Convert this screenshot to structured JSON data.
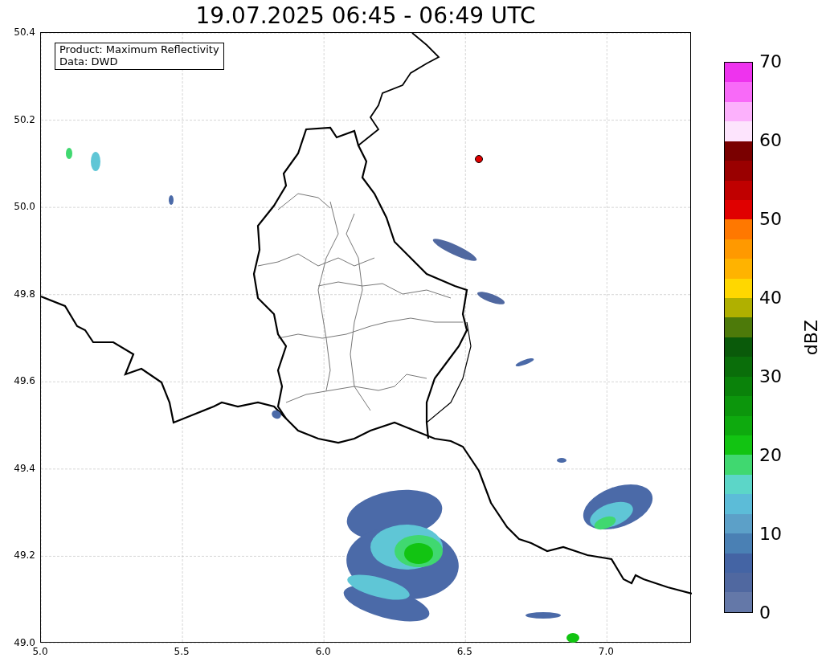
{
  "title": "19.07.2025 06:45 - 06:49 UTC",
  "legend": [
    "Product: Maximum Reflectivity",
    "Data: DWD"
  ],
  "x_ticks": [
    "5.0",
    "5.5",
    "6.0",
    "6.5",
    "7.0"
  ],
  "y_ticks": [
    "50.4",
    "50.2",
    "50.0",
    "49.8",
    "49.6",
    "49.4",
    "49.2",
    "49.0"
  ],
  "colorbar": {
    "label": "dBZ",
    "ticks": [
      "70",
      "60",
      "50",
      "40",
      "30",
      "20",
      "10",
      "0"
    ],
    "segments": [
      {
        "color": "#ee33ee"
      },
      {
        "color": "#f86af8"
      },
      {
        "color": "#fcb1fc"
      },
      {
        "color": "#fde4fd"
      },
      {
        "color": "#7a0000"
      },
      {
        "color": "#9a0000"
      },
      {
        "color": "#c00000"
      },
      {
        "color": "#e00000"
      },
      {
        "color": "#ff7800"
      },
      {
        "color": "#ff9900"
      },
      {
        "color": "#ffb300"
      },
      {
        "color": "#ffd700"
      },
      {
        "color": "#b0b000"
      },
      {
        "color": "#4d7a0a"
      },
      {
        "color": "#0a5a0a"
      },
      {
        "color": "#0a6e0a"
      },
      {
        "color": "#0a820a"
      },
      {
        "color": "#0c960c"
      },
      {
        "color": "#0eaa0e"
      },
      {
        "color": "#12c412"
      },
      {
        "color": "#40d870"
      },
      {
        "color": "#5cd6c8"
      },
      {
        "color": "#5cbcd8"
      },
      {
        "color": "#5ca0c8"
      },
      {
        "color": "#4a80b4"
      },
      {
        "color": "#4464a4"
      },
      {
        "color": "#5068a0"
      },
      {
        "color": "#6478a8"
      }
    ]
  }
}
